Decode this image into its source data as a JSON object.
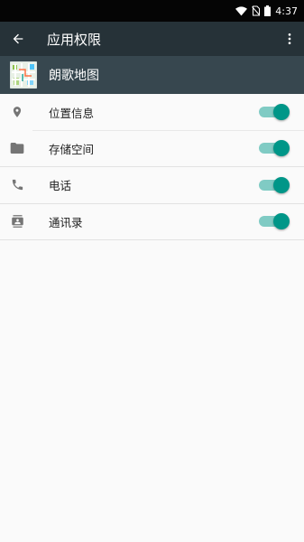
{
  "status_bar": {
    "time": "4:37",
    "icons": [
      "wifi-icon",
      "no-sim-icon",
      "battery-icon"
    ]
  },
  "toolbar": {
    "title": "应用权限",
    "back_icon": "arrow-back-icon",
    "menu_icon": "more-vert-icon"
  },
  "app": {
    "name": "朗歌地图",
    "icon": "map-app-icon"
  },
  "permissions": [
    {
      "label": "位置信息",
      "icon": "location-pin-icon",
      "enabled": true
    },
    {
      "label": "存储空间",
      "icon": "folder-icon",
      "enabled": true
    },
    {
      "label": "电话",
      "icon": "phone-icon",
      "enabled": true
    },
    {
      "label": "通讯录",
      "icon": "contacts-icon",
      "enabled": true
    }
  ],
  "colors": {
    "toolbar": "#263238",
    "app_header": "#37474f",
    "switch_on_thumb": "#009688",
    "switch_on_track": "#80cbc4"
  }
}
